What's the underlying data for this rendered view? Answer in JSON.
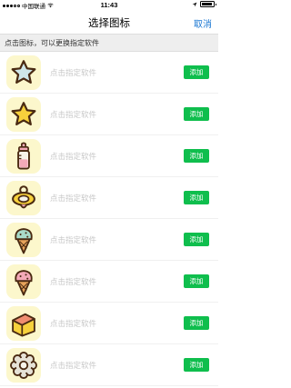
{
  "status_bar": {
    "carrier": "中国联通",
    "time": "11:43",
    "battery_level": 0.95
  },
  "nav": {
    "title": "选择图标",
    "cancel_label": "取消"
  },
  "hint": {
    "text": "点击图标，可以更换指定软件"
  },
  "rows": [
    {
      "icon": "star-outline-icon",
      "label": "点击指定软件",
      "button": "添加"
    },
    {
      "icon": "star-yellow-icon",
      "label": "点击指定软件",
      "button": "添加"
    },
    {
      "icon": "baby-bottle-icon",
      "label": "点击指定软件",
      "button": "添加"
    },
    {
      "icon": "pacifier-icon",
      "label": "点击指定软件",
      "button": "添加"
    },
    {
      "icon": "ice-cream-mint-icon",
      "label": "点击指定软件",
      "button": "添加"
    },
    {
      "icon": "ice-cream-pink-icon",
      "label": "点击指定软件",
      "button": "添加"
    },
    {
      "icon": "cake-icon",
      "label": "点击指定软件",
      "button": "添加"
    },
    {
      "icon": "flower-gear-icon",
      "label": "点击指定软件",
      "button": "添加"
    }
  ],
  "colors": {
    "accent_blue": "#1976d2",
    "add_green": "#0fbe4d",
    "tile_bg": "#fcf7cc",
    "outline": "#4a2a12"
  }
}
